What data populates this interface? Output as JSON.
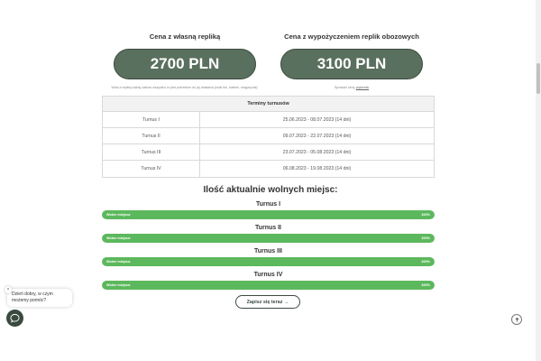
{
  "pricing": {
    "own": {
      "title": "Cena z własną repliką",
      "price": "2700 PLN",
      "note": "Wiać a repliką każdy zabrać wszystko co jest potrzebne do jej działania (kulki bio, baterie, magazynki)."
    },
    "rental": {
      "title": "Cena z wypożyczeniem replik obozowych",
      "price": "3100 PLN",
      "note_prefix": "Sprawdź cenę ",
      "note_link": "pojemnik"
    }
  },
  "terms": {
    "header": "Terminy turnusów",
    "rows": [
      {
        "name": "Turnus I",
        "dates": "25.06.2023 - 08.07.2023 (14 dni)"
      },
      {
        "name": "Turnus II",
        "dates": "09.07.2023 - 22.07.2023 (14 dni)"
      },
      {
        "name": "Turnus III",
        "dates": "23.07.2023 - 05.08.2023 (14 dni)"
      },
      {
        "name": "Turnus IV",
        "dates": "06.08.2023 - 19.08.2023 (14 dni)"
      }
    ]
  },
  "availability": {
    "title": "Ilość aktualnie wolnych miejsc:",
    "items": [
      {
        "label": "Turnus I",
        "bar_text": "Wolne miejsca",
        "percent_text": "100%",
        "fraction": 1.0
      },
      {
        "label": "Turnus II",
        "bar_text": "Wolne miejsca",
        "percent_text": "100%",
        "fraction": 1.0
      },
      {
        "label": "Turnus III",
        "bar_text": "Wolne miejsca",
        "percent_text": "100%",
        "fraction": 1.0
      },
      {
        "label": "Turnus IV",
        "bar_text": "Wolne miejsca",
        "percent_text": "100%",
        "fraction": 1.0
      }
    ]
  },
  "cta": {
    "label": "Zapisz się teraz →"
  },
  "chat": {
    "message": "Dzień dobry, w czym możemy pomóc?",
    "close_icon": "close-icon",
    "button_icon": "chat-icon"
  },
  "colors": {
    "pill": "#5a705f",
    "bar": "#5cb85c",
    "accent_dark": "#3b4a3f"
  }
}
